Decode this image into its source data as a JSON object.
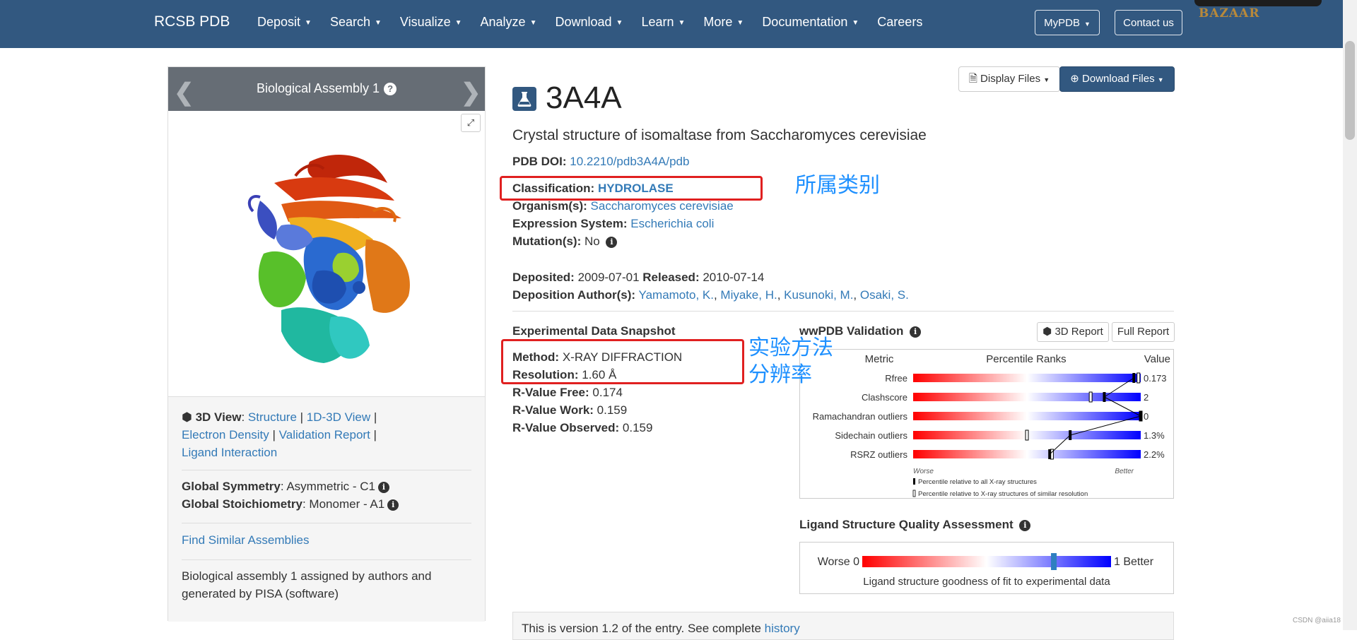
{
  "navbar": {
    "brand": "RCSB PDB",
    "items": [
      "Deposit",
      "Search",
      "Visualize",
      "Analyze",
      "Download",
      "Learn",
      "More",
      "Documentation",
      "Careers"
    ],
    "mypdb": "MyPDB",
    "contact": "Contact us",
    "ad_text": "BAZAAR"
  },
  "left": {
    "assembly_title": "Biological Assembly 1",
    "view_label": "3D View",
    "links": [
      "Structure",
      "1D-3D View",
      "Electron Density",
      "Validation Report",
      "Ligand Interaction"
    ],
    "global_symmetry_label": "Global Symmetry",
    "global_symmetry_value": ": Asymmetric - C1",
    "global_stoich_label": "Global Stoichiometry",
    "global_stoich_value": ": Monomer - A1",
    "find_similar": "Find Similar Assemblies",
    "assembly_note": "Biological assembly 1 assigned by authors and generated by PISA (software)"
  },
  "entry": {
    "id": "3A4A",
    "title": "Crystal structure of isomaltase from Saccharomyces cerevisiae",
    "display_files": "Display Files",
    "download_files": "Download Files",
    "doi_label": "PDB DOI:",
    "doi_value": "10.2210/pdb3A4A/pdb",
    "classification_label": "Classification:",
    "classification_value": "HYDROLASE",
    "organism_label": "Organism(s):",
    "organism_value": "Saccharomyces cerevisiae",
    "expression_label": "Expression System:",
    "expression_value": "Escherichia coli",
    "mutation_label": "Mutation(s):",
    "mutation_value": "No",
    "deposited_label": "Deposited:",
    "deposited_value": "2009-07-01",
    "released_label": "Released:",
    "released_value": "2010-07-14",
    "authors_label": "Deposition Author(s):",
    "authors": [
      "Yamamoto, K.",
      "Miyake, H.",
      "Kusunoki, M.",
      "Osaki, S."
    ]
  },
  "experimental": {
    "heading": "Experimental Data Snapshot",
    "method_label": "Method:",
    "method_value": "X-RAY DIFFRACTION",
    "resolution_label": "Resolution:",
    "resolution_value": "1.60 Å",
    "rfree_label": "R-Value Free:",
    "rfree_value": "0.174",
    "rwork_label": "R-Value Work:",
    "rwork_value": "0.159",
    "robs_label": "R-Value Observed:",
    "robs_value": "0.159"
  },
  "validation": {
    "heading": "wwPDB Validation",
    "report_3d": "3D Report",
    "full_report": "Full Report",
    "col_metric": "Metric",
    "col_percentile": "Percentile Ranks",
    "col_value": "Value",
    "worse": "Worse",
    "better": "Better",
    "legend_all": "Percentile relative to all X-ray structures",
    "legend_similar": "Percentile relative to X-ray structures of similar resolution",
    "metrics": [
      {
        "name": "Rfree",
        "value": "0.173",
        "all_pct": 0.97,
        "sim_pct": 0.99
      },
      {
        "name": "Clashscore",
        "value": "2",
        "all_pct": 0.84,
        "sim_pct": 0.78
      },
      {
        "name": "Ramachandran outliers",
        "value": "0",
        "all_pct": 1.0,
        "sim_pct": 1.0
      },
      {
        "name": "Sidechain outliers",
        "value": "1.3%",
        "all_pct": 0.69,
        "sim_pct": 0.5
      },
      {
        "name": "RSRZ outliers",
        "value": "2.2%",
        "all_pct": 0.6,
        "sim_pct": 0.61
      }
    ]
  },
  "ligand": {
    "heading": "Ligand Structure Quality Assessment",
    "worse_label": "Worse 0",
    "better_label": "1 Better",
    "marker_value": 0.77,
    "caption": "Ligand structure goodness of fit to experimental data"
  },
  "annotations": {
    "classification": "所属类别",
    "method_line1": "实验方法",
    "method_line2": "分辨率"
  },
  "version_note": {
    "text": "This is version 1.2 of the entry. See complete",
    "link": "history"
  },
  "watermark": "CSDN @aiia18",
  "colors": {
    "navbar": "#325880",
    "link": "#337ab7",
    "annotation_box": "#e02020",
    "annotation_text": "#1e90ff"
  }
}
